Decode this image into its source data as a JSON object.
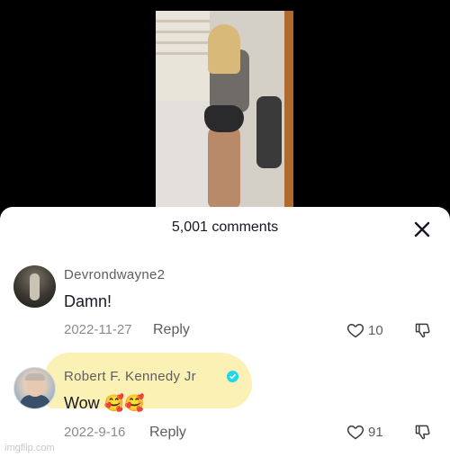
{
  "video": {
    "icon": "video-thumbnail"
  },
  "comments_panel": {
    "title": "5,001 comments",
    "close_icon": "close-icon"
  },
  "comments": [
    {
      "username": "Devrondwayne2",
      "text": "Damn!",
      "date": "2022-11-27",
      "reply_label": "Reply",
      "likes": "10"
    },
    {
      "username": "Robert  F.  Kennedy  Jr",
      "verified": true,
      "text": "Wow",
      "emojis": "🥰🥰",
      "date": "2022-9-16",
      "reply_label": "Reply",
      "likes": "91"
    }
  ],
  "watermark": "imgflip.com",
  "colors": {
    "verified": "#20d5ec",
    "highlight": "#fbeea8"
  }
}
